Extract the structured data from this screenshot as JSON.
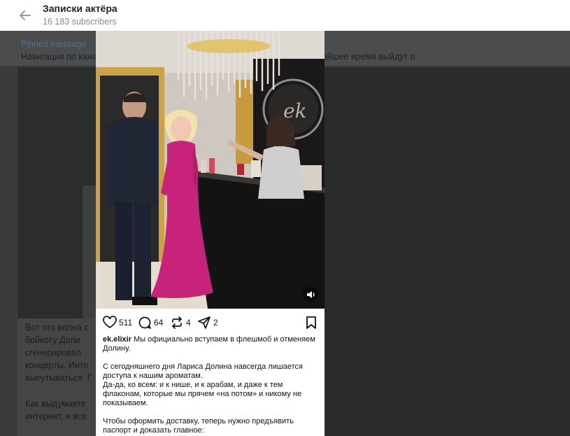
{
  "header": {
    "title": "Записки актёра",
    "subscribers": "16 183 subscribers"
  },
  "pinned": {
    "label": "Pinned message",
    "text": "Навигация по каналу. Здесь собраны придуманные мной рубрики. В ближайшее время выйдут о"
  },
  "background_message": {
    "lines": [
      "Вот это волна с",
      "бойкоту Доли",
      "сгенерировал",
      "концерты. Инте",
      "выпутываться. Г",
      "",
      "Как выдумаете",
      "интернет, и все"
    ]
  },
  "post": {
    "likes": "511",
    "comments": "64",
    "reposts": "4",
    "shares": "2",
    "caption": {
      "username": "ek.elixir",
      "p1_rest": "Мы официально вступаем в флешмоб и отменяем Долину.",
      "p2_l1": "С сегодняшнего дня Лариса Долина навсегда лишается",
      "p2_l2": "доступа к нашим ароматам.",
      "p3_l1": "Да-да, ко всем: и к нише, и к арабам, и даже к тем",
      "p3_l2": "флаконам, которые мы прячем «на потом» и никому не",
      "p3_l3": "показываем.",
      "p4_l1": "Чтобы оформить доставку, теперь нужно предъявить",
      "p4_l2": "паспорт и доказать главное:"
    }
  },
  "colors": {
    "accent": "#4f6f8c",
    "dress": "#c8237a"
  }
}
